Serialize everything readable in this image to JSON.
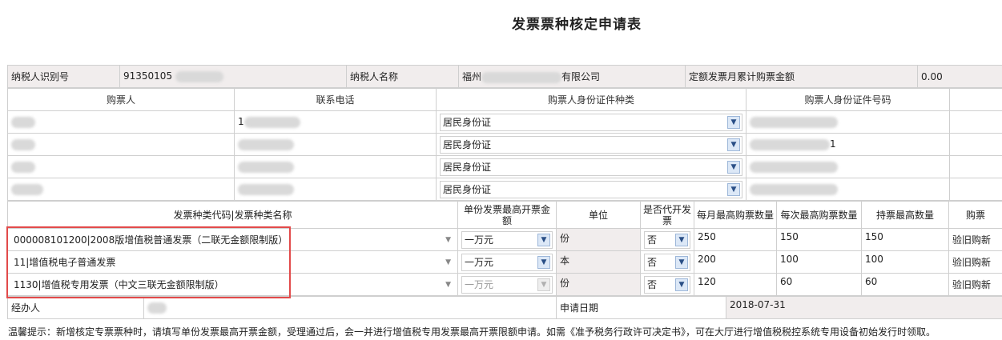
{
  "title": "发票票种核定申请表",
  "taxpayer": {
    "id_label": "纳税人识别号",
    "id_value": "91350105",
    "name_label": "纳税人名称",
    "name_prefix": "福州",
    "name_suffix": "有限公司",
    "amount_label": "定额发票月累计购票金额",
    "amount_value": "0.00"
  },
  "buyers": {
    "headers": [
      "购票人",
      "联系电话",
      "购票人身份证件种类",
      "购票人身份证件号码"
    ],
    "rows": [
      {
        "id_type": "居民身份证",
        "phone_prefix": "1",
        "id_suffix": ""
      },
      {
        "id_type": "居民身份证",
        "phone_prefix": "",
        "id_suffix": "1"
      },
      {
        "id_type": "居民身份证",
        "phone_prefix": "",
        "id_suffix": ""
      },
      {
        "id_type": "居民身份证",
        "phone_prefix": "",
        "id_suffix": ""
      }
    ]
  },
  "invoices": {
    "headers": [
      "发票种类代码|发票种类名称",
      "单份发票最高开票金额",
      "单位",
      "是否代开发票",
      "每月最高购票数量",
      "每次最高购票数量",
      "持票最高数量",
      "购票"
    ],
    "rows": [
      {
        "type": "000008101200|2008版增值税普通发票（二联无金额限制版）",
        "max_amount": "一万元",
        "unit": "份",
        "agent": "否",
        "monthly": "250",
        "per_time": "150",
        "hold": "150",
        "method": "验旧购新",
        "amount_disabled": false
      },
      {
        "type": "11|增值税电子普通发票",
        "max_amount": "一万元",
        "unit": "本",
        "agent": "否",
        "monthly": "200",
        "per_time": "100",
        "hold": "100",
        "method": "验旧购新",
        "amount_disabled": false
      },
      {
        "type": "1130|增值税专用发票（中文三联无金额限制版）",
        "max_amount": "一万元",
        "unit": "份",
        "agent": "否",
        "monthly": "120",
        "per_time": "60",
        "hold": "60",
        "method": "验旧购新",
        "amount_disabled": true
      }
    ]
  },
  "footer": {
    "handler_label": "经办人",
    "date_label": "申请日期",
    "date_value": "2018-07-31"
  },
  "tip": "温馨提示：新增核定专票票种时，请填写单份发票最高开票金额，受理通过后，会一并进行增值税专用发票最高开票限额申请。如需《准予税务行政许可决定书》，可在大厅进行增值税税控系统专用设备初始发行时领取。",
  "colors": {
    "highlight_box": "#e24a4a",
    "readonly_bg": "#f1eded",
    "select_arrow_bg": "#dce8f7"
  }
}
